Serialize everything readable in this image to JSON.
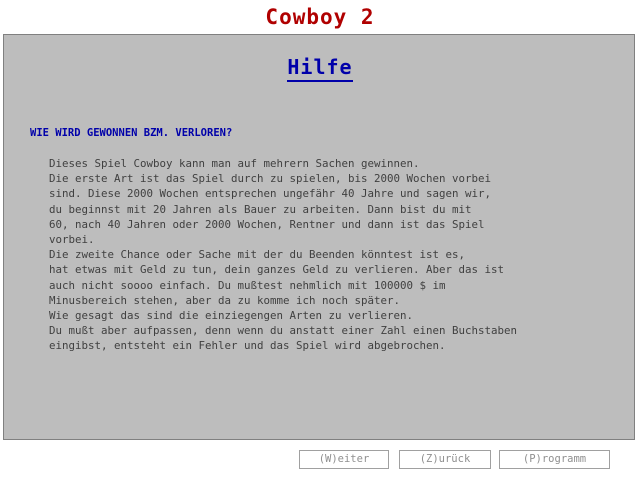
{
  "app": {
    "title": "Cowboy 2"
  },
  "help": {
    "heading": "Hilfe",
    "question": "WIE WIRD GEWONNEN BZM. VERLOREN?",
    "lines": [
      "Dieses Spiel Cowboy kann man auf mehrern Sachen gewinnen.",
      "Die erste Art ist das Spiel durch zu spielen, bis 2000 Wochen vorbei",
      "sind. Diese 2000 Wochen entsprechen ungefähr 40 Jahre und sagen wir,",
      "du beginnst mit 20 Jahren als Bauer zu arbeiten. Dann bist du mit",
      "60, nach 40 Jahren oder 2000 Wochen, Rentner und dann ist das Spiel",
      "vorbei.",
      "Die zweite Chance oder Sache mit der du Beenden könntest ist es,",
      "hat etwas mit Geld zu tun, dein ganzes Geld zu verlieren. Aber das ist",
      "auch nicht soooo einfach. Du mußtest nehmlich mit 100000 $ im",
      "Minusbereich stehen, aber da zu komme ich noch später.",
      "Wie gesagt das sind die einziegengen Arten zu verlieren.",
      "Du mußt aber aufpassen, denn wenn du anstatt einer Zahl einen Buchstaben",
      "eingibst, entsteht ein Fehler und das Spiel wird abgebrochen."
    ]
  },
  "footer": {
    "weiter_label": "(W)eiter",
    "zurueck_label": "(Z)urück",
    "programm_label": "(P)rogramm"
  },
  "colors": {
    "title": "#b00000",
    "heading": "#0000aa",
    "panel_bg": "#bdbdbd",
    "body_text": "#404040",
    "button_text": "#909090"
  }
}
